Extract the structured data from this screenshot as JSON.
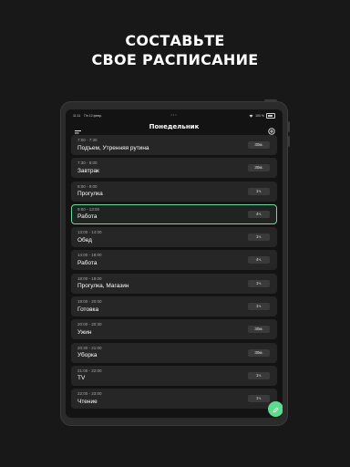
{
  "headline": {
    "line1": "СОСТАВЬТЕ",
    "line2": "СВОЕ РАСПИСАНИЕ"
  },
  "statusbar": {
    "time": "11:11",
    "date": "Пн 12 февр.",
    "battery_percent": "100 %"
  },
  "app": {
    "title": "Понедельник",
    "menu_icon": "menu-icon",
    "settings_icon": "settings-icon",
    "fab_icon": "pencil-icon"
  },
  "colors": {
    "accent": "#5ddc8d",
    "active_border": "#74d6a2"
  },
  "items": [
    {
      "time": "7:00 - 7:30",
      "name": "Подъем, Утренняя рутина",
      "duration": "30м.",
      "active": false
    },
    {
      "time": "7:30 - 8:00",
      "name": "Завтрак",
      "duration": "30м.",
      "active": false
    },
    {
      "time": "8:00 - 9:00",
      "name": "Прогулка",
      "duration": "1ч.",
      "active": false
    },
    {
      "time": "9:00 - 13:00",
      "name": "Работа",
      "duration": "4ч.",
      "active": true
    },
    {
      "time": "13:00 - 14:00",
      "name": "Обед",
      "duration": "1ч.",
      "active": false
    },
    {
      "time": "14:00 - 18:00",
      "name": "Работа",
      "duration": "4ч.",
      "active": false
    },
    {
      "time": "18:00 - 19:00",
      "name": "Прогулка, Магазин",
      "duration": "1ч.",
      "active": false
    },
    {
      "time": "19:00 - 20:00",
      "name": "Готовка",
      "duration": "1ч.",
      "active": false
    },
    {
      "time": "20:00 - 20:30",
      "name": "Ужин",
      "duration": "30м.",
      "active": false
    },
    {
      "time": "20:30 - 21:00",
      "name": "Уборка",
      "duration": "30м.",
      "active": false
    },
    {
      "time": "21:00 - 22:00",
      "name": "TV",
      "duration": "1ч.",
      "active": false
    },
    {
      "time": "22:00 - 23:00",
      "name": "Чтение",
      "duration": "1ч.",
      "active": false
    }
  ]
}
